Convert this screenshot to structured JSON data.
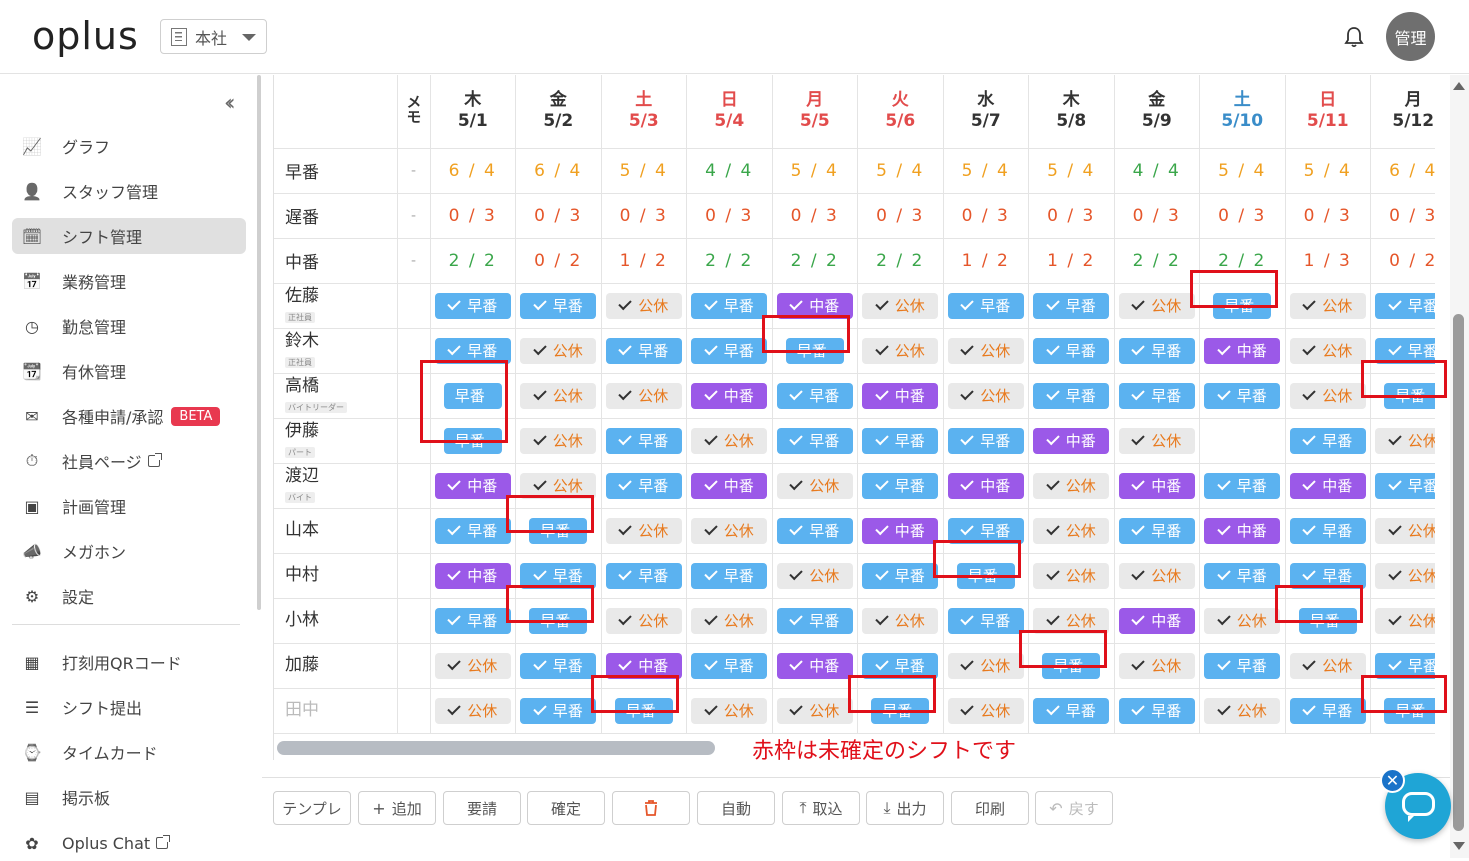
{
  "header": {
    "logo": "oplus",
    "store": "本社",
    "avatar": "管理"
  },
  "sidebar": {
    "items": [
      {
        "label": "グラフ",
        "icon": "chart-icon"
      },
      {
        "label": "スタッフ管理",
        "icon": "user-icon"
      },
      {
        "label": "シフト管理",
        "icon": "calendar-check-icon",
        "active": true
      },
      {
        "label": "業務管理",
        "icon": "calendar-clock-icon"
      },
      {
        "label": "勤怠管理",
        "icon": "clock-icon"
      },
      {
        "label": "有休管理",
        "icon": "calendar-x-icon"
      },
      {
        "label": "各種申請/承認",
        "icon": "request-icon",
        "badge": "BETA"
      },
      {
        "label": "社員ページ",
        "icon": "stopwatch-icon",
        "external": true
      },
      {
        "label": "計画管理",
        "icon": "id-card-icon"
      },
      {
        "label": "メガホン",
        "icon": "megaphone-icon"
      },
      {
        "label": "設定",
        "icon": "gear-icon"
      },
      {
        "label": "打刻用QRコード",
        "icon": "qr-icon"
      },
      {
        "label": "シフト提出",
        "icon": "list-icon"
      },
      {
        "label": "タイムカード",
        "icon": "timecard-icon"
      },
      {
        "label": "掲示板",
        "icon": "board-icon"
      },
      {
        "label": "Oplus Chat",
        "icon": "chat-icon",
        "external": true
      }
    ]
  },
  "table": {
    "memo_header": "メモ",
    "days": [
      {
        "dow": "木",
        "date": "5/1",
        "kind": "weekday"
      },
      {
        "dow": "金",
        "date": "5/2",
        "kind": "weekday"
      },
      {
        "dow": "土",
        "date": "5/3",
        "kind": "holiday"
      },
      {
        "dow": "日",
        "date": "5/4",
        "kind": "holiday"
      },
      {
        "dow": "月",
        "date": "5/5",
        "kind": "holiday"
      },
      {
        "dow": "火",
        "date": "5/6",
        "kind": "holiday"
      },
      {
        "dow": "水",
        "date": "5/7",
        "kind": "weekday"
      },
      {
        "dow": "木",
        "date": "5/8",
        "kind": "weekday"
      },
      {
        "dow": "金",
        "date": "5/9",
        "kind": "weekday"
      },
      {
        "dow": "土",
        "date": "5/10",
        "kind": "saturday"
      },
      {
        "dow": "日",
        "date": "5/11",
        "kind": "holiday"
      },
      {
        "dow": "月",
        "date": "5/12",
        "kind": "weekday"
      }
    ],
    "summary": [
      {
        "label": "早番",
        "memo": "-",
        "values": [
          "6 / 4",
          "6 / 4",
          "5 / 4",
          "4 / 4",
          "5 / 4",
          "5 / 4",
          "5 / 4",
          "5 / 4",
          "4 / 4",
          "5 / 4",
          "5 / 4",
          "6 / 4"
        ],
        "colors": [
          "o",
          "o",
          "o",
          "g",
          "o",
          "o",
          "o",
          "o",
          "g",
          "o",
          "o",
          "o"
        ]
      },
      {
        "label": "遅番",
        "memo": "-",
        "values": [
          "0 / 3",
          "0 / 3",
          "0 / 3",
          "0 / 3",
          "0 / 3",
          "0 / 3",
          "0 / 3",
          "0 / 3",
          "0 / 3",
          "0 / 3",
          "0 / 3",
          "0 / 3"
        ],
        "colors": [
          "r",
          "r",
          "r",
          "r",
          "r",
          "r",
          "r",
          "r",
          "r",
          "r",
          "r",
          "r"
        ]
      },
      {
        "label": "中番",
        "memo": "-",
        "values": [
          "2 / 2",
          "0 / 2",
          "1 / 2",
          "2 / 2",
          "2 / 2",
          "2 / 2",
          "1 / 2",
          "1 / 2",
          "2 / 2",
          "2 / 2",
          "1 / 3",
          "0 / 2"
        ],
        "colors": [
          "g",
          "r",
          "r",
          "g",
          "g",
          "g",
          "r",
          "r",
          "g",
          "g",
          "r",
          "r"
        ]
      }
    ],
    "staff": [
      {
        "name": "佐藤",
        "role": "正社員",
        "shifts": [
          "E",
          "E",
          "O",
          "E",
          "M",
          "O",
          "E",
          "E",
          "O",
          "e",
          "O",
          "E"
        ]
      },
      {
        "name": "鈴木",
        "role": "正社員",
        "shifts": [
          "E",
          "O",
          "E",
          "E",
          "e",
          "O",
          "O",
          "E",
          "E",
          "M",
          "O",
          "E"
        ]
      },
      {
        "name": "高橋",
        "role": "バイトリーダー",
        "shifts": [
          "e",
          "O",
          "O",
          "M",
          "E",
          "M",
          "O",
          "E",
          "E",
          "E",
          "O",
          "e"
        ]
      },
      {
        "name": "伊藤",
        "role": "パート",
        "shifts": [
          "e",
          "O",
          "E",
          "O",
          "E",
          "E",
          "E",
          "M",
          "O",
          "",
          "E",
          "O"
        ]
      },
      {
        "name": "渡辺",
        "role": "バイト",
        "shifts": [
          "M",
          "O",
          "E",
          "M",
          "O",
          "E",
          "M",
          "O",
          "M",
          "E",
          "M",
          "E"
        ]
      },
      {
        "name": "山本",
        "role": "",
        "shifts": [
          "E",
          "e",
          "O",
          "O",
          "E",
          "M",
          "E",
          "O",
          "E",
          "M",
          "E",
          "O"
        ]
      },
      {
        "name": "中村",
        "role": "",
        "shifts": [
          "M",
          "E",
          "E",
          "E",
          "O",
          "E",
          "e",
          "O",
          "O",
          "E",
          "E",
          "O"
        ]
      },
      {
        "name": "小林",
        "role": "",
        "shifts": [
          "E",
          "e",
          "O",
          "O",
          "E",
          "O",
          "E",
          "O",
          "M",
          "O",
          "e",
          "O"
        ]
      },
      {
        "name": "加藤",
        "role": "",
        "shifts": [
          "O",
          "E",
          "M",
          "E",
          "M",
          "E",
          "O",
          "e",
          "O",
          "E",
          "O",
          "E"
        ]
      },
      {
        "name": "田中",
        "role": "",
        "dim": true,
        "shifts": [
          "O",
          "E",
          "e",
          "O",
          "O",
          "e",
          "O",
          "E",
          "E",
          "O",
          "E",
          "e"
        ]
      }
    ],
    "chip_labels": {
      "early": "早番",
      "mid": "中番",
      "off": "公休"
    }
  },
  "note": "赤枠は未確定のシフトです",
  "toolbar": {
    "template": "テンプレ",
    "add": "追加",
    "request": "要請",
    "confirm": "確定",
    "auto": "自動",
    "import": "取込",
    "export": "出力",
    "print": "印刷",
    "undo": "戻す"
  },
  "colors": {
    "early": "#5bb2f0",
    "mid": "#9b59e8",
    "off_text": "#e87a1e",
    "unconfirmed_box": "#e0101a"
  }
}
